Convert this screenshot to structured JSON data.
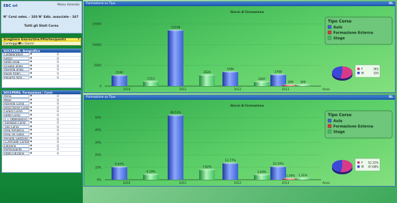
{
  "company": "EBC srl",
  "mode_label": "Mono Azienda",
  "stats_line": "N° Corsi selez. - 103   N° Ediz. associate - 167",
  "all_states": "Tutti gli Stati Corso",
  "selector": {
    "title": "Scegliere Giorni/Ore/#Partecipanti)",
    "help": "?",
    "field": "Conteggio in:",
    "value": "Giorni"
  },
  "panel1": {
    "title": "SOCI/PERS. Anagrafica",
    "rows": [
      "Collaboratore",
      "Sesso",
      "Stato anag.",
      "Gruppo anag.",
      "Azienda anag.",
      "Ruolo Azien...",
      "Reparto Azie..."
    ]
  },
  "panel2": {
    "title": "SOCI/PERS. Formazione / Corsi",
    "rows": [
      "Anno",
      "Mese",
      "Azienda Corso",
      "Descrizione Corso",
      "Codice Corso",
      "Stato Corso",
      "1 = Obbligatorio",
      "Tipologia Corso",
      "Tipo Corso",
      "Area tematica",
      "Area (di ruolo)",
      "Periodo Gestione",
      "1=Periodo Corrente",
      "Edizione",
      "Partecipante",
      "Stato Edizione"
    ]
  },
  "check_mark": "O",
  "arrow_mark": "▼",
  "legend": {
    "title": "Tipo Corso",
    "items": [
      "Aula",
      "Formazione Esterna",
      "Stage"
    ]
  },
  "colors": {
    "aula": "#3d63d0",
    "esterna": "#d83a3a",
    "stage": "#3fbf5f",
    "header": "#1d56a8"
  },
  "chart1": {
    "panel_title": "Formazione su Tipo",
    "icon_label": "XL",
    "title": "Giorni di Formazione",
    "xaxis": "Anno",
    "ticks": [
      "15000",
      "10000",
      "5000",
      "0"
    ],
    "pie_labels": [
      "F",
      "M"
    ],
    "pie_values": [
      "365",
      "330"
    ]
  },
  "chart2": {
    "panel_title": "Formazione su Tipo",
    "icon_label": "XL",
    "title": "Giorni di Formazione",
    "xaxis": "Anno",
    "ticks": [
      "50%",
      "40%",
      "30%",
      "20%",
      "10%",
      "0%"
    ],
    "pie_labels": [
      "F",
      "M"
    ],
    "pie_values": [
      "52,32%",
      "47,68%"
    ]
  },
  "chart_data": [
    {
      "type": "bar",
      "title": "Giorni di Formazione",
      "xlabel": "Anno",
      "ylabel": "",
      "ylim": [
        0,
        16500
      ],
      "categories": [
        "2010",
        "2011",
        "2012",
        "2013"
      ],
      "series": [
        {
          "name": "Aula",
          "values": [
            2540,
            13108,
            3384,
            2708
          ]
        },
        {
          "name": "Formazione Esterna",
          "values": [
            0,
            0,
            0,
            289
          ]
        },
        {
          "name": "Stage",
          "values": [
            1113,
            2624,
            1047,
            349
          ]
        }
      ],
      "labels": [
        "2540",
        "1113",
        "13108",
        "2624",
        "3384",
        "1047",
        "2708",
        "289",
        "349"
      ],
      "pie": {
        "labels": [
          "F",
          "M"
        ],
        "values": [
          365,
          330
        ]
      }
    },
    {
      "type": "bar",
      "title": "Giorni di Formazione",
      "xlabel": "Anno",
      "ylabel": "",
      "ylim": [
        0,
        54
      ],
      "categories": [
        "2010",
        "2011",
        "2012",
        "2013"
      ],
      "series": [
        {
          "name": "Aula",
          "values": [
            9.92,
            49.51,
            12.77,
            10.19
          ]
        },
        {
          "name": "Formazione Esterna",
          "values": [
            0,
            0,
            0,
            1.08
          ]
        },
        {
          "name": "Stage",
          "values": [
            4.19,
            7.82,
            3.94,
            1.31
          ]
        }
      ],
      "labels": [
        "9,92%",
        "4,19%",
        "49,51%",
        "7,82%",
        "12,77%",
        "3,94%",
        "10,19%",
        "1,08%",
        "1,31%"
      ],
      "pie": {
        "labels": [
          "F",
          "M"
        ],
        "values": [
          52.32,
          47.68
        ]
      }
    }
  ]
}
